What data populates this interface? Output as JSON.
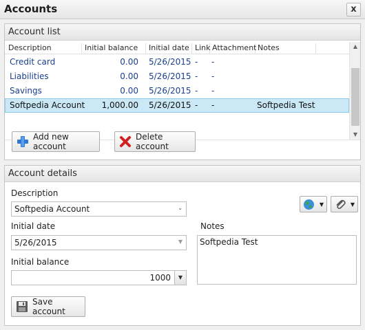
{
  "window": {
    "title": "Accounts",
    "close_label": "x"
  },
  "account_list": {
    "header": "Account list",
    "columns": [
      "Description",
      "Initial balance",
      "Initial date",
      "Link",
      "Attachment",
      "Notes"
    ],
    "rows": [
      {
        "description": "Credit card",
        "balance": "0.00",
        "date": "5/26/2015",
        "link": "-",
        "attachment": "-",
        "notes": ""
      },
      {
        "description": "Liabilities",
        "balance": "0.00",
        "date": "5/26/2015",
        "link": "-",
        "attachment": "-",
        "notes": ""
      },
      {
        "description": "Savings",
        "balance": "0.00",
        "date": "5/26/2015",
        "link": "-",
        "attachment": "-",
        "notes": ""
      },
      {
        "description": "Softpedia Account",
        "balance": "1,000.00",
        "date": "5/26/2015",
        "link": "-",
        "attachment": "-",
        "notes": "Softpedia Test"
      }
    ],
    "selected_index": 3,
    "add_button": "Add new account",
    "delete_button": "Delete account"
  },
  "account_details": {
    "header": "Account details",
    "description_label": "Description",
    "description_value": "Softpedia Account",
    "date_label": "Initial date",
    "date_value": "5/26/2015",
    "balance_label": "Initial balance",
    "balance_value": "1000",
    "notes_label": "Notes",
    "notes_value": "Softpedia Test",
    "save_button": "Save account"
  },
  "icons": {
    "add": "plus-icon",
    "delete": "x-icon",
    "save": "floppy-disk-icon",
    "link": "globe-icon",
    "attach": "paperclip-icon",
    "scroll_up": "▲",
    "scroll_down": "▼",
    "combo_arrow": "⌄",
    "spin_arrow": "▼",
    "caret": "▼"
  },
  "colors": {
    "selected_row": "#cbe8f6",
    "link_text": "#1a3f8f",
    "add_icon": "#2f78d4",
    "delete_icon": "#d11e1e"
  }
}
